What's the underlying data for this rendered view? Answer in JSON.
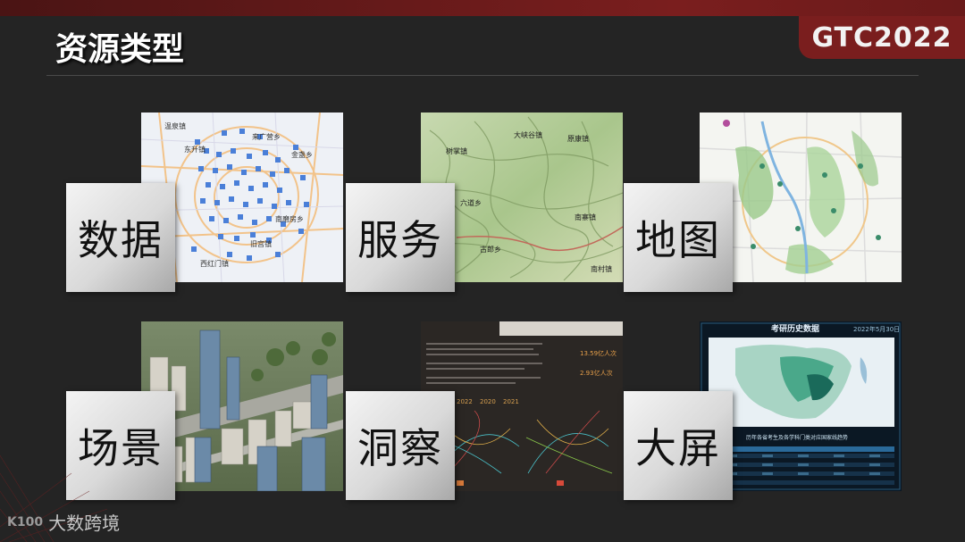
{
  "header": {
    "title": "资源类型",
    "logo": "GTC2022"
  },
  "cards": [
    {
      "label": "数据",
      "icon": "data-map-thumbnail",
      "places": [
        "温泉镇",
        "东升镇",
        "来广营乡",
        "宋家庄",
        "西红门镇",
        "南磨房乡",
        "金盏乡",
        "旧宫镇"
      ]
    },
    {
      "label": "服务",
      "icon": "terrain-map-thumbnail",
      "places": [
        "大峡谷镇",
        "原康镇",
        "树掌镇",
        "六道乡",
        "南寨镇",
        "古郎乡",
        "南村镇"
      ]
    },
    {
      "label": "地图",
      "icon": "city-map-thumbnail",
      "places": []
    },
    {
      "label": "场景",
      "icon": "3d-city-thumbnail",
      "places": []
    },
    {
      "label": "洞察",
      "icon": "insight-report-thumbnail",
      "stats": [
        "13.59亿人次",
        "2.93亿人次"
      ],
      "years": [
        "2022",
        "2020",
        "2021"
      ]
    },
    {
      "label": "大屏",
      "icon": "dashboard-thumbnail",
      "dash_title": "考研历史数据",
      "dash_date": "2022年5月30日",
      "dash_subtitle": "历年各省考生及各学科门类对应国家线趋势"
    }
  ],
  "watermark": {
    "logo": "K100",
    "text": "大数跨境"
  }
}
